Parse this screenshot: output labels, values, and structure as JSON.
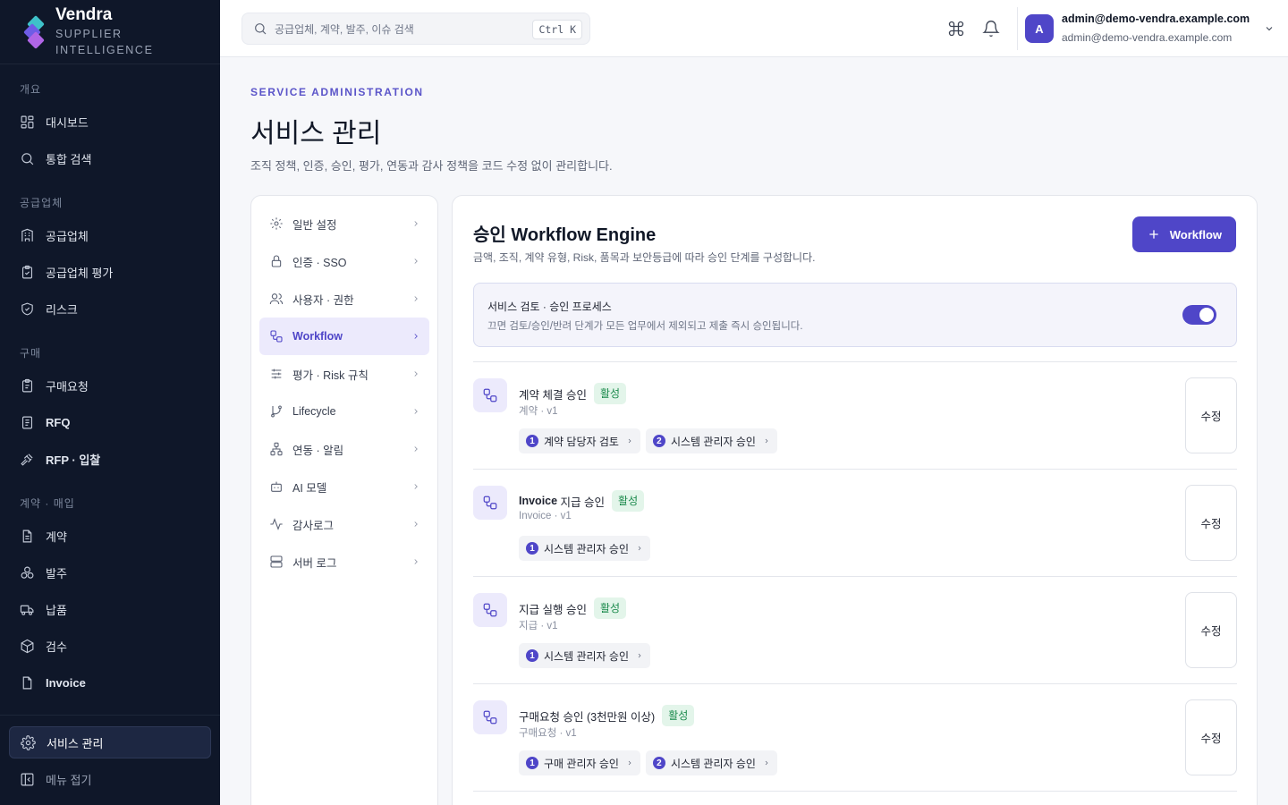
{
  "brand": {
    "name": "Vendra",
    "subtitle_line1": "SUPPLIER",
    "subtitle_line2": "INTELLIGENCE",
    "colors": [
      "#3ec1c9",
      "#6e5ce6",
      "#b065e6"
    ]
  },
  "sidebar": {
    "sections": [
      {
        "label": "개요",
        "items": [
          {
            "label": "대시보드",
            "icon": "dashboard-icon"
          },
          {
            "label": "통합 검색",
            "icon": "search-icon"
          }
        ]
      },
      {
        "label": "공급업체",
        "items": [
          {
            "label": "공급업체",
            "icon": "building-icon"
          },
          {
            "label": "공급업체 평가",
            "icon": "clipboard-check-icon"
          },
          {
            "label": "리스크",
            "icon": "shield-check-icon"
          }
        ]
      },
      {
        "label": "구매",
        "items": [
          {
            "label": "구매요청",
            "icon": "clipboard-icon"
          },
          {
            "label": "RFQ",
            "icon": "document-icon"
          },
          {
            "label": "RFP · 입찰",
            "icon": "gavel-icon"
          }
        ]
      },
      {
        "label": "계약 · 매입",
        "items": [
          {
            "label": "계약",
            "icon": "file-text-icon"
          },
          {
            "label": "발주",
            "icon": "boxes-icon"
          },
          {
            "label": "납품",
            "icon": "truck-icon"
          },
          {
            "label": "검수",
            "icon": "package-check-icon"
          },
          {
            "label": "Invoice",
            "icon": "invoice-icon"
          }
        ]
      }
    ],
    "bottom": {
      "admin_label": "서비스 관리",
      "collapse_label": "메뉴 접기"
    }
  },
  "topbar": {
    "search_placeholder": "공급업체, 계약, 발주, 이슈 검색",
    "shortcut": "Ctrl K",
    "user_initial": "A",
    "user_name": "admin@demo-vendra.example.com",
    "user_email": "admin@demo-vendra.example.com"
  },
  "page": {
    "eyebrow": "SERVICE ADMINISTRATION",
    "title": "서비스 관리",
    "description": "조직 정책, 인증, 승인, 평가, 연동과 감사 정책을 코드 수정 없이 관리합니다."
  },
  "settings_nav": {
    "items": [
      {
        "label": "일반 설정",
        "icon": "gear-icon"
      },
      {
        "label": "인증 · SSO",
        "icon": "lock-icon"
      },
      {
        "label": "사용자 · 권한",
        "icon": "users-icon"
      },
      {
        "label": "Workflow",
        "icon": "workflow-icon",
        "active": true
      },
      {
        "label": "평가 · Risk 규칙",
        "icon": "sliders-icon"
      },
      {
        "label": "Lifecycle",
        "icon": "git-branch-icon"
      },
      {
        "label": "연동 · 알림",
        "icon": "network-icon"
      },
      {
        "label": "AI 모델",
        "icon": "bot-icon"
      },
      {
        "label": "감사로그",
        "icon": "activity-icon"
      },
      {
        "label": "서버 로그",
        "icon": "server-icon"
      }
    ]
  },
  "workflow_panel": {
    "title_prefix": "승인",
    "title_bold": "Workflow Engine",
    "description": "금액, 조직, 계약 유형, Risk, 품목과 보안등급에 따라 승인 단계를 구성합니다.",
    "add_button": "Workflow",
    "toggle": {
      "title": "서비스 검토 · 승인 프로세스",
      "description": "끄면 검토/승인/반려 단계가 모든 업무에서 제외되고 제출 즉시 승인됩니다.",
      "enabled": true
    },
    "edit_label": "수정",
    "workflows": [
      {
        "name_bold": "",
        "name": "계약 체결 승인",
        "status": "활성",
        "meta": "계약 · v1",
        "steps": [
          {
            "num": "1",
            "label": "계약 담당자 검토"
          },
          {
            "num": "2",
            "label": "시스템 관리자 승인"
          }
        ]
      },
      {
        "name_bold": "Invoice",
        "name": " 지급 승인",
        "status": "활성",
        "meta": "Invoice · v1",
        "steps": [
          {
            "num": "1",
            "label": "시스템 관리자 승인"
          }
        ]
      },
      {
        "name_bold": "",
        "name": "지급 실행 승인",
        "status": "활성",
        "meta": "지급 · v1",
        "steps": [
          {
            "num": "1",
            "label": "시스템 관리자 승인"
          }
        ]
      },
      {
        "name_bold": "",
        "name": "구매요청 승인 (3천만원 이상)",
        "status": "활성",
        "meta": "구매요청 · v1",
        "steps": [
          {
            "num": "1",
            "label": "구매 관리자 승인"
          },
          {
            "num": "2",
            "label": "시스템 관리자 승인"
          }
        ]
      }
    ]
  }
}
